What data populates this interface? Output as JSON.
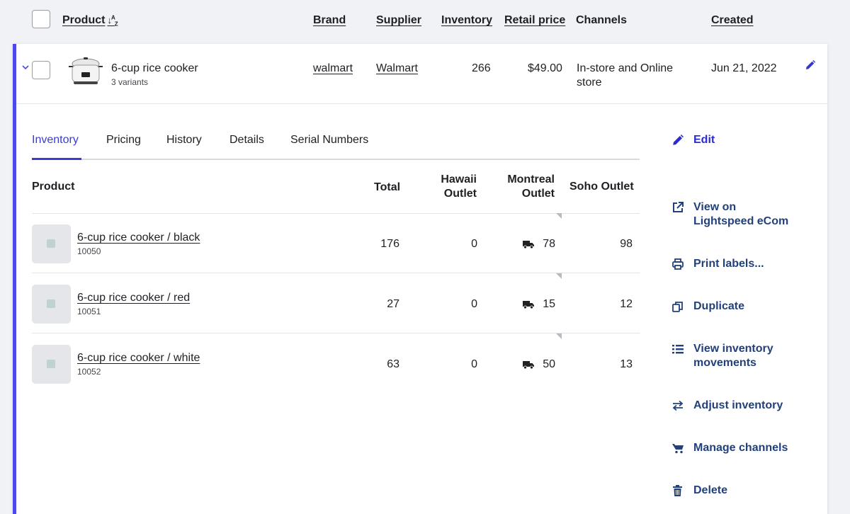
{
  "header": {
    "product": "Product",
    "sort_glyph": "↓A/Z",
    "brand": "Brand",
    "supplier": "Supplier",
    "inventory": "Inventory",
    "retail_price": "Retail price",
    "channels": "Channels",
    "created": "Created"
  },
  "product": {
    "name": "6-cup rice cooker",
    "variants": "3 variants",
    "brand": "walmart",
    "supplier": "Walmart",
    "inventory": "266",
    "price": "$49.00",
    "channels_line1": "In-store and Online",
    "channels_line2": "store",
    "created": "Jun 21, 2022"
  },
  "tabs": [
    "Inventory",
    "Pricing",
    "History",
    "Details",
    "Serial Numbers"
  ],
  "table": {
    "col_product": "Product",
    "col_total": "Total",
    "col_hawaii_1": "Hawaii",
    "col_hawaii_2": "Outlet",
    "col_montreal_1": "Montreal",
    "col_montreal_2": "Outlet",
    "col_soho": "Soho Outlet",
    "rows": [
      {
        "name": "6-cup rice cooker / black",
        "sku": "10050",
        "total": "176",
        "hawaii": "0",
        "montreal": "78",
        "soho": "98"
      },
      {
        "name": "6-cup rice cooker / red",
        "sku": "10051",
        "total": "27",
        "hawaii": "0",
        "montreal": "15",
        "soho": "12"
      },
      {
        "name": "6-cup rice cooker / white",
        "sku": "10052",
        "total": "63",
        "hawaii": "0",
        "montreal": "50",
        "soho": "13"
      }
    ]
  },
  "actions": {
    "edit": "Edit",
    "view_1": "View on",
    "view_2": "Lightspeed eCom",
    "print": "Print labels...",
    "duplicate": "Duplicate",
    "movements_1": "View inventory",
    "movements_2": "movements",
    "adjust": "Adjust inventory",
    "manage": "Manage channels",
    "delete": "Delete"
  },
  "colors": {
    "accent": "#4a4ae8",
    "action_text": "#22407a",
    "background": "#f1f2f6"
  }
}
